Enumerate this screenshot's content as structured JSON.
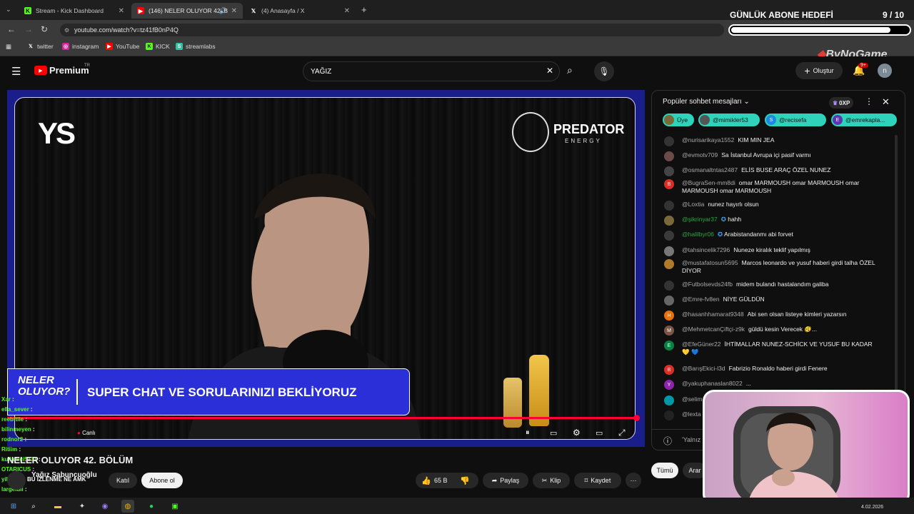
{
  "tabs": [
    {
      "title": "Stream - Kick Dashboard"
    },
    {
      "title": "(146) NELER OLUYOR 42. B"
    },
    {
      "title": "(4) Anasayfa / X"
    }
  ],
  "address": {
    "url": "youtube.com/watch?v=tz41fB0nP4Q"
  },
  "bookmarks": [
    "twitter",
    "instagram",
    "YouTube",
    "KICK",
    "streamlabs"
  ],
  "goal": {
    "title": "GÜNLÜK ABONE HEDEFİ",
    "current": "9",
    "sep": "/",
    "total": "10",
    "progress": 0.9
  },
  "watermark": "ByNoGame",
  "youtube": {
    "logo_text": "Premium",
    "region": "TR",
    "search_value": "YAĞIZ",
    "create_label": "Oluştur",
    "notif_count": "9+",
    "avatar_letter": "n"
  },
  "video": {
    "brand_logo": "YS",
    "sponsor_name": "PREDATOR",
    "sponsor_sub": "ENERGY",
    "banner_logo_line1": "NELER",
    "banner_logo_line2": "OLUYOR?",
    "banner_text": "SUPER CHAT VE SORULARINIZI BEKLİYORUZ",
    "live_label": "Canlı",
    "progress": 1.0
  },
  "title": "NELER OLUYOR 42. BÖLÜM",
  "channel": "Yağız Sabuncuoğlu",
  "actions": {
    "join": "Katıl",
    "subscribe": "Abone ol",
    "likes": "65 B",
    "share": "Paylaş",
    "clip": "Klip",
    "save": "Kaydet"
  },
  "chat": {
    "header": "Popüler sohbet mesajları",
    "points": "0XP",
    "pills": [
      "Üye",
      "@mimikler53",
      "@recisefa",
      "@emrekapla..."
    ],
    "messages": [
      {
        "author": "@nurisarikaya1552",
        "text": "KIM MIN JEA",
        "av": "",
        "color": "#333"
      },
      {
        "author": "@evmotv709",
        "text": "Sa İstanbul Avrupa içi pasif varmı",
        "av": "",
        "color": "#6b4a4a"
      },
      {
        "author": "@osmanaltntas2487",
        "text": "ELİS BUSE ARAÇ ÖZEL NUNEZ",
        "av": "",
        "color": "#444"
      },
      {
        "author": "@BugraSen-mm8di",
        "text": "omar MARMOUSH omar MARMOUSH omar MARMOUSH omar MARMOUSH",
        "av": "B",
        "color": "#d93025"
      },
      {
        "author": "@Loxtia",
        "text": "nunez hayırlı olsun",
        "av": "",
        "color": "#333"
      },
      {
        "author": "@şikrinyar37",
        "text": "hahh",
        "av": "",
        "color": "#7a6a3a",
        "member": true
      },
      {
        "author": "@halilbyr06",
        "text": "Arabistandanmı abi forvet",
        "av": "",
        "color": "#3a3a3a",
        "member": true
      },
      {
        "author": "@tahsincelik7296",
        "text": "Nuneze kiralık teklif yapılmış",
        "av": "",
        "color": "#777"
      },
      {
        "author": "@mustafatosun5695",
        "text": "Marcos leonardo ve yusuf haberi girdi talha ÖZEL DİYOR",
        "av": "",
        "color": "#b07a2a"
      },
      {
        "author": "@Futbolsevds24fb",
        "text": "midem bulandı hastalandım galiba",
        "av": "",
        "color": "#333"
      },
      {
        "author": "@Emre-fv8en",
        "text": "NİYE GÜLDÜN",
        "av": "",
        "color": "#666"
      },
      {
        "author": "@hasanhhamarat9348",
        "text": "Abi sen olsan listeye kimleri yazarsın",
        "av": "H",
        "color": "#e8710a"
      },
      {
        "author": "@MehmetcanÇiftçi-z9k",
        "text": "güldü kesin Verecek 🫨...",
        "av": "M",
        "color": "#795548"
      },
      {
        "author": "@EfeGüner22",
        "text": "İHTİMALLAR NUNEZ-SCHİCK VE YUSUF BU KADAR 💛 💙",
        "av": "E",
        "color": "#0b8043"
      },
      {
        "author": "@BarışEkici-l3d",
        "text": "Fabrizio Ronaldo haberi girdi Fenere",
        "av": "B",
        "color": "#d93025"
      },
      {
        "author": "@yakuphanaslan8022",
        "text": "...",
        "av": "Y",
        "color": "#8e24aa"
      },
      {
        "author": "@selim",
        "text": "",
        "av": "",
        "color": "#0097a7"
      },
      {
        "author": "@lexta",
        "text": "",
        "av": "",
        "color": "#222"
      }
    ],
    "input_placeholder": "'Yalnız",
    "filter_all": "Tümü",
    "filter_other": "Arar"
  },
  "overlay_chat": [
    {
      "user": "Xar",
      "text": ""
    },
    {
      "user": "ella_sever",
      "text": ""
    },
    {
      "user": "reebftlle",
      "text": ""
    },
    {
      "user": "bilinmeyen",
      "text": ""
    },
    {
      "user": "rodnor2",
      "text": ""
    },
    {
      "user": "Ritiim",
      "text": ""
    },
    {
      "user": "kullanici5131",
      "text": ""
    },
    {
      "user": "OTARICUS",
      "text": ""
    },
    {
      "user": "yildiz88",
      "text": "BU İZLENME NE AMK"
    },
    {
      "user": "largeldii",
      "text": ""
    }
  ],
  "taskbar": {
    "date": "4.02.2026"
  }
}
